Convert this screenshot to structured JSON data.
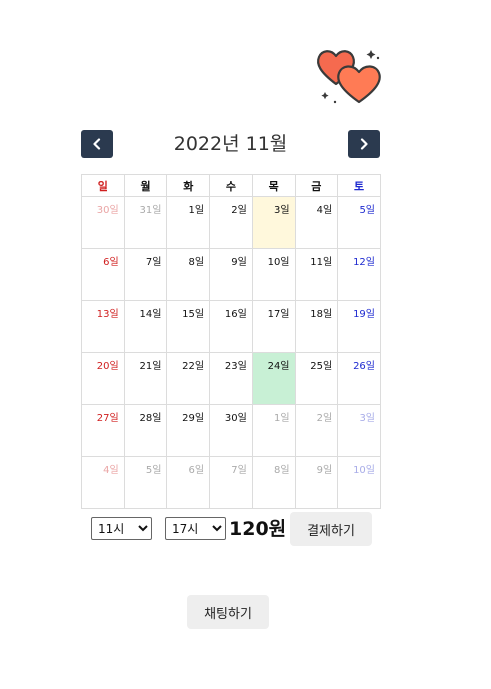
{
  "calendar": {
    "title": "2022년 11월",
    "weekdays": [
      "일",
      "월",
      "화",
      "수",
      "목",
      "금",
      "토"
    ],
    "weeks": [
      [
        {
          "d": "30일",
          "o": true
        },
        {
          "d": "31일",
          "o": true
        },
        {
          "d": "1일"
        },
        {
          "d": "2일"
        },
        {
          "d": "3일",
          "today": true
        },
        {
          "d": "4일"
        },
        {
          "d": "5일"
        }
      ],
      [
        {
          "d": "6일"
        },
        {
          "d": "7일"
        },
        {
          "d": "8일"
        },
        {
          "d": "9일"
        },
        {
          "d": "10일"
        },
        {
          "d": "11일"
        },
        {
          "d": "12일"
        }
      ],
      [
        {
          "d": "13일"
        },
        {
          "d": "14일"
        },
        {
          "d": "15일"
        },
        {
          "d": "16일"
        },
        {
          "d": "17일"
        },
        {
          "d": "18일"
        },
        {
          "d": "19일"
        }
      ],
      [
        {
          "d": "20일"
        },
        {
          "d": "21일"
        },
        {
          "d": "22일"
        },
        {
          "d": "23일"
        },
        {
          "d": "24일",
          "selected": true
        },
        {
          "d": "25일"
        },
        {
          "d": "26일"
        }
      ],
      [
        {
          "d": "27일"
        },
        {
          "d": "28일"
        },
        {
          "d": "29일"
        },
        {
          "d": "30일"
        },
        {
          "d": "1일",
          "o": true
        },
        {
          "d": "2일",
          "o": true
        },
        {
          "d": "3일",
          "o": true
        }
      ],
      [
        {
          "d": "4일",
          "o": true
        },
        {
          "d": "5일",
          "o": true
        },
        {
          "d": "6일",
          "o": true
        },
        {
          "d": "7일",
          "o": true
        },
        {
          "d": "8일",
          "o": true
        },
        {
          "d": "9일",
          "o": true
        },
        {
          "d": "10일",
          "o": true
        }
      ]
    ],
    "colors": {
      "sunday": "#d01f1f",
      "saturday": "#1f2bd0",
      "today_bg": "#fff8dc",
      "selected_bg": "#c8f0d5",
      "nav_button_bg": "#2b3a4f"
    }
  },
  "nav": {
    "prev_icon": "chevron-left-icon",
    "next_icon": "chevron-right-icon"
  },
  "decor": {
    "icon": "hearts-icon",
    "colors": [
      "#f56a4f",
      "#ff7b55"
    ]
  },
  "booking": {
    "start_time": "11시",
    "end_time": "17시",
    "price": "120원",
    "pay_label": "결제하기"
  },
  "chat": {
    "label": "채팅하기"
  }
}
